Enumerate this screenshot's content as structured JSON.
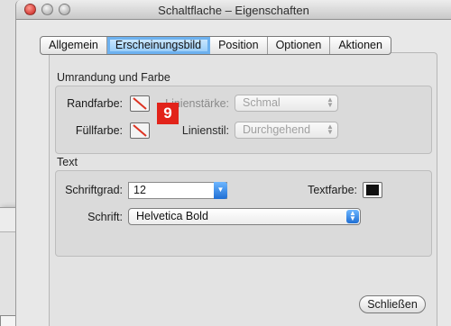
{
  "window": {
    "title": "Schaltflache – Eigenschaften"
  },
  "tabs": [
    {
      "label": "Allgemein",
      "active": false
    },
    {
      "label": "Erscheinungsbild",
      "active": true
    },
    {
      "label": "Position",
      "active": false
    },
    {
      "label": "Optionen",
      "active": false
    },
    {
      "label": "Aktionen",
      "active": false
    }
  ],
  "border_group": {
    "title": "Umrandung und Farbe",
    "border_color_label": "Randfarbe:",
    "fill_color_label": "Füllfarbe:",
    "line_width_label": "Linienstärke:",
    "line_width_value": "Schmal",
    "line_style_label": "Linienstil:",
    "line_style_value": "Durchgehend"
  },
  "badge": "9",
  "text_group": {
    "title": "Text",
    "font_size_label": "Schriftgrad:",
    "font_size_value": "12",
    "text_color_label": "Textfarbe:",
    "font_label": "Schrift:",
    "font_value": "Helvetica Bold"
  },
  "close_button": "Schließen",
  "colors": {
    "accent": "#1f6fd4",
    "badge": "#e2231a",
    "text_color": "#111111"
  }
}
